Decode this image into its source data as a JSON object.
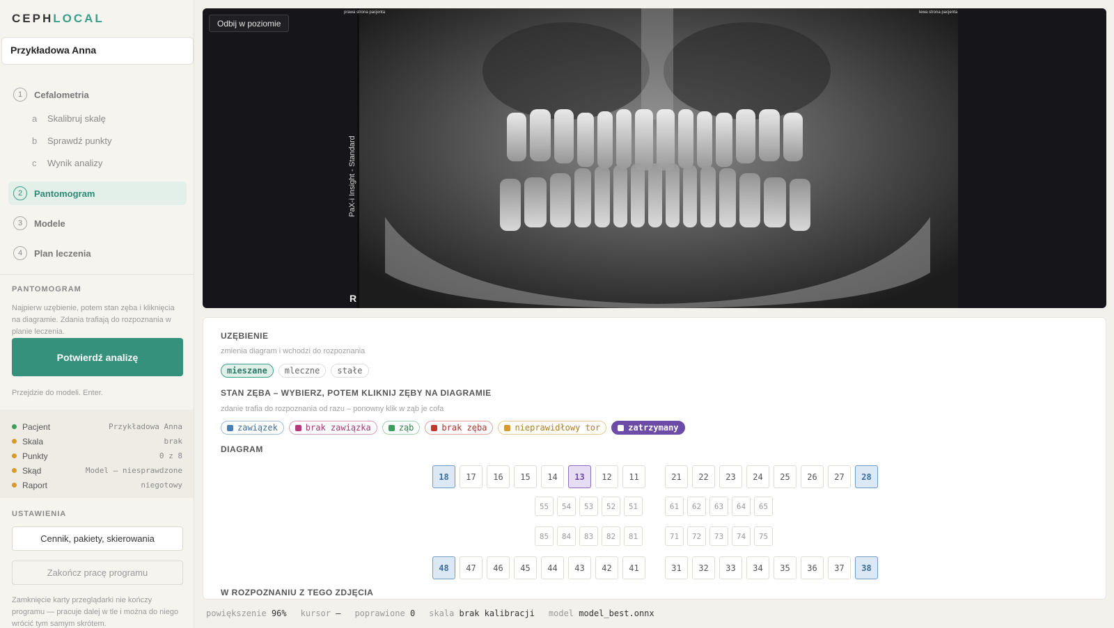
{
  "app": {
    "logo_part1": "CEPH",
    "logo_part2": "LOCAL"
  },
  "sidebar": {
    "patient_name": "Przykładowa Anna",
    "steps": [
      {
        "num": "1",
        "label": "Cefalometria"
      },
      {
        "num": "2",
        "label": "Pantomogram"
      },
      {
        "num": "3",
        "label": "Modele"
      },
      {
        "num": "4",
        "label": "Plan leczenia"
      }
    ],
    "substeps": [
      {
        "letter": "a",
        "label": "Skalibruj skalę"
      },
      {
        "letter": "b",
        "label": "Sprawdź punkty"
      },
      {
        "letter": "c",
        "label": "Wynik analizy"
      }
    ],
    "section_title": "PANTOMOGRAM",
    "help": "Najpierw uzębienie, potem stan zęba i kliknięcia na diagramie. Zdania trafiają do rozpoznania w planie leczenia.",
    "confirm_button": "Potwierdź analizę",
    "confirm_hint": "Przejdzie do modeli. Enter.",
    "status": [
      {
        "label": "Pacjent",
        "value": "Przykładowa Anna",
        "color": "#3b9e5c"
      },
      {
        "label": "Skala",
        "value": "brak",
        "color": "#d79a2b"
      },
      {
        "label": "Punkty",
        "value": "0 z 8",
        "color": "#d79a2b"
      },
      {
        "label": "Skąd",
        "value": "Model — niesprawdzone",
        "color": "#d79a2b"
      },
      {
        "label": "Raport",
        "value": "niegotowy",
        "color": "#d79a2b"
      }
    ],
    "settings_title": "USTAWIENIA",
    "pricing_button": "Cennik, pakiety, skierowania",
    "quit_button": "Zakończ pracę programu",
    "quit_note": "Zamknięcie karty przeglądarki nie kończy programu — pracuje dalej w tle i można do niego wrócić tym samym skrótem."
  },
  "xray": {
    "flip_button": "Odbij w poziomie",
    "vertical_label": "PaX-i Insight - Standard",
    "r_marker": "R",
    "corner_left": "prawa strona pacjenta",
    "corner_right": "lewa strona pacjenta"
  },
  "panel": {
    "dentition_title": "UZĘBIENIE",
    "dentition_sub": "zmienia diagram i wchodzi do rozpoznania",
    "dentition_chips": [
      "mieszane",
      "mleczne",
      "stałe"
    ],
    "state_title": "STAN ZĘBA – WYBIERZ, POTEM KLIKNIJ ZĘBY NA DIAGRAMIE",
    "state_sub": "zdanie trafia do rozpoznania od razu – ponowny klik w ząb je cofa",
    "state_chips": [
      {
        "label": "zawiązek",
        "color": "#4a7fb5",
        "border": "#9cbbdb",
        "text": "#3a6ea0"
      },
      {
        "label": "brak zawiązka",
        "color": "#b53a7c",
        "border": "#d89cbd",
        "text": "#a23570"
      },
      {
        "label": "ząb",
        "color": "#3b9e5c",
        "border": "#9fd1b0",
        "text": "#2e7d4a"
      },
      {
        "label": "brak zęba",
        "color": "#c0392b",
        "border": "#e3a39c",
        "text": "#a83226"
      },
      {
        "label": "nieprawidłowy tor",
        "color": "#d79a2b",
        "border": "#e9c98e",
        "text": "#b07d1f"
      },
      {
        "label": "zatrzymany",
        "color": "#ffffff",
        "border": "#6d4ca8",
        "text": "#ffffff"
      }
    ],
    "diagram_title": "DIAGRAM",
    "upper_right": [
      "18",
      "17",
      "16",
      "15",
      "14",
      "13",
      "12",
      "11"
    ],
    "upper_left": [
      "21",
      "22",
      "23",
      "24",
      "25",
      "26",
      "27",
      "28"
    ],
    "deci_upper_right": [
      "55",
      "54",
      "53",
      "52",
      "51"
    ],
    "deci_upper_left": [
      "61",
      "62",
      "63",
      "64",
      "65"
    ],
    "deci_lower_right": [
      "85",
      "84",
      "83",
      "82",
      "81"
    ],
    "deci_lower_left": [
      "71",
      "72",
      "73",
      "74",
      "75"
    ],
    "lower_right": [
      "48",
      "47",
      "46",
      "45",
      "44",
      "43",
      "42",
      "41"
    ],
    "lower_left": [
      "31",
      "32",
      "33",
      "34",
      "35",
      "36",
      "37",
      "38"
    ],
    "highlight_blue": [
      "18",
      "28",
      "48",
      "38"
    ],
    "highlight_purple": [
      "13"
    ],
    "diagnosis_title": "W ROZPOZNANIU Z TEGO ZDJĘCIA"
  },
  "statusbar": {
    "zoom_label": "powiększenie",
    "zoom_value": "96%",
    "cursor_label": "kursor",
    "cursor_value": "—",
    "fixed_label": "poprawione",
    "fixed_value": "0",
    "scale_label": "skala",
    "scale_value": "brak kalibracji",
    "model_label": "model",
    "model_value": "model_best.onnx"
  }
}
